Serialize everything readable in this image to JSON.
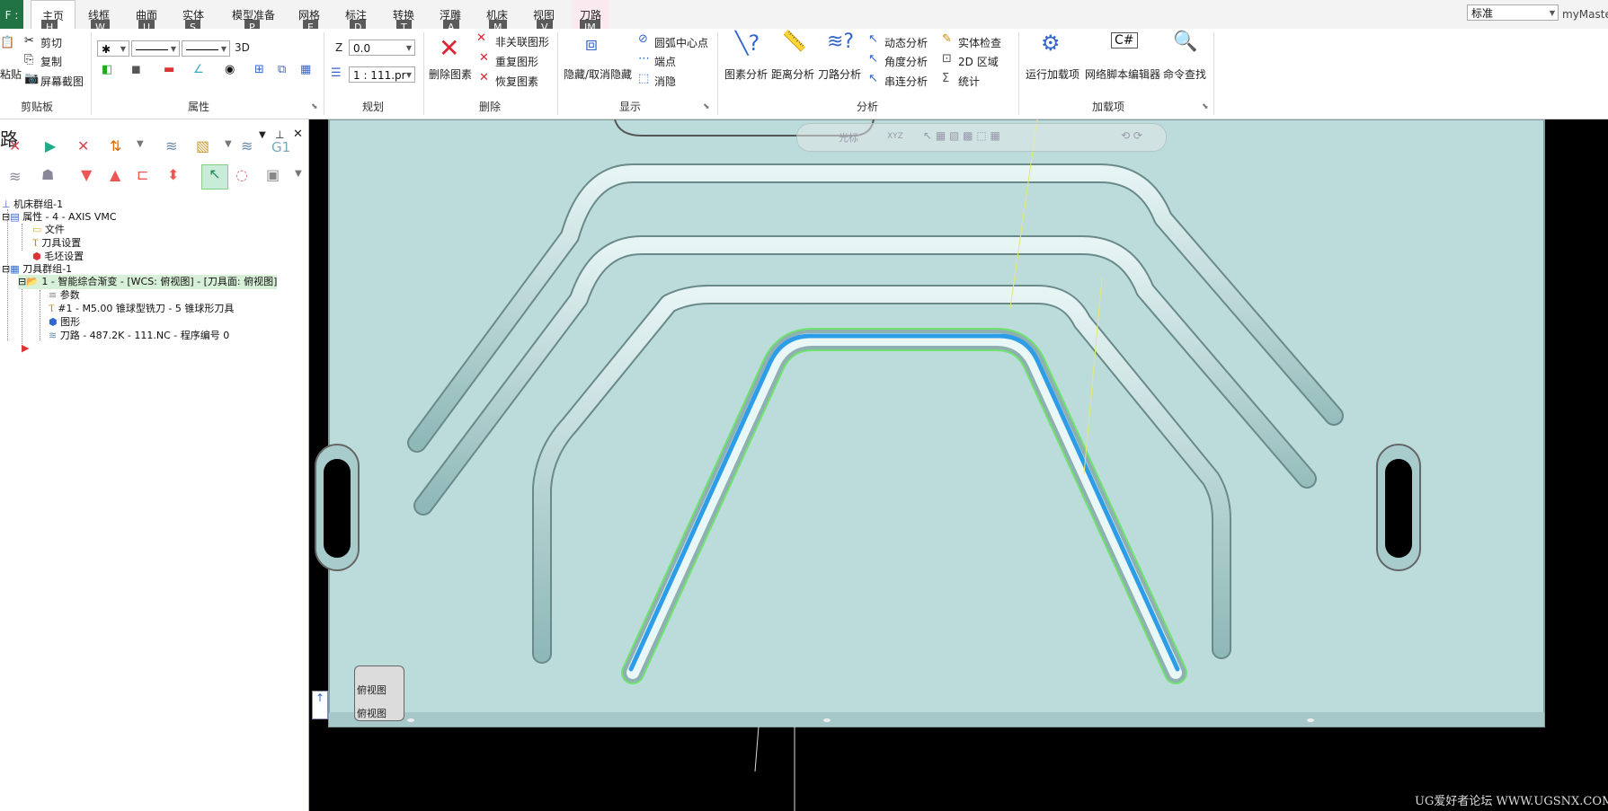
{
  "tabs": {
    "file": "F :",
    "items": [
      {
        "label": "主页",
        "key": "H",
        "active": true
      },
      {
        "label": "线框",
        "key": "W"
      },
      {
        "label": "曲面",
        "key": "U"
      },
      {
        "label": "实体",
        "key": "S"
      },
      {
        "label": "模型准备",
        "key": "P"
      },
      {
        "label": "网格",
        "key": "E"
      },
      {
        "label": "标注",
        "key": "D"
      },
      {
        "label": "转换",
        "key": "T"
      },
      {
        "label": "浮雕",
        "key": "A"
      },
      {
        "label": "机床",
        "key": "M"
      },
      {
        "label": "视图",
        "key": "V"
      },
      {
        "label": "刀路",
        "key": "JM"
      }
    ],
    "style_value": "标准",
    "user_label": "myMaste"
  },
  "ribbon": {
    "clipboard": {
      "paste": "粘贴",
      "cut": "剪切",
      "copy": "复制",
      "screenshot": "屏幕截图",
      "label": "剪贴板"
    },
    "attributes": {
      "label": "属性",
      "three_d": "3D"
    },
    "plan": {
      "z_label": "Z",
      "z_value": "0.0",
      "scale_value": "1 : 111.pr",
      "label": "规划"
    },
    "delete": {
      "delete_entity": "删除图素",
      "delete_non_assoc": "非关联图形",
      "duplicate": "重复图形",
      "restore": "恢复图素",
      "label": "删除"
    },
    "display": {
      "hide_unhide": "隐藏/取消隐藏",
      "arc_center": "圆弧中心点",
      "endpoint": "端点",
      "blank": "消隐",
      "label": "显示"
    },
    "analyze": {
      "entity": "图素分析",
      "distance": "距离分析",
      "toolpath": "刀路分析",
      "dynamic": "动态分析",
      "angle": "角度分析",
      "chain": "串连分析",
      "solid_check": "实体检查",
      "area_2d": "2D 区域",
      "statistics": "统计",
      "label": "分析"
    },
    "addins": {
      "run": "运行加载项",
      "net_script": "网络脚本编辑器",
      "cmd_find": "命令查找",
      "label": "加载项"
    }
  },
  "panel": {
    "title": "路",
    "tree": [
      {
        "text": "机床群组-1"
      },
      {
        "text": "属性 - 4 - AXIS VMC"
      },
      {
        "text": "文件"
      },
      {
        "text": "刀具设置"
      },
      {
        "text": "毛坯设置"
      },
      {
        "text": "刀具群组-1"
      },
      {
        "text": "1 - 智能综合渐变 - [WCS: 俯视图] - [刀具面: 俯视图]"
      },
      {
        "text": "参数"
      },
      {
        "text": "#1 - M5.00 锥球型铣刀 - 5 锥球形刀具"
      },
      {
        "text": "图形"
      },
      {
        "text": "刀路 - 487.2K - 111.NC - 程序编号 0"
      }
    ],
    "g1_label": "G1"
  },
  "viewport": {
    "selection_bar_label": "光标",
    "xyz_label": "XYZ",
    "view_cube_label": "俯视图",
    "view_cube_label2": "俯视图",
    "watermark": "UG爱好者论坛 WWW.UGSNX.COM"
  },
  "colors": {
    "part_fill": "#bcdcdc",
    "toolpath_blue": "#2e9de8",
    "toolpath_green": "#6fe26f",
    "file_tab": "#217346"
  }
}
